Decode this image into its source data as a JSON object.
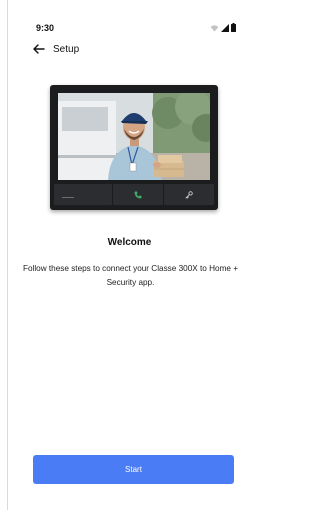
{
  "status_bar": {
    "time": "9:30",
    "icons": [
      "wifi-icon",
      "cellular-signal-icon",
      "battery-icon"
    ]
  },
  "app_bar": {
    "back_icon": "arrow-left-icon",
    "title": "Setup"
  },
  "hero": {
    "device_image": "intercom-device-with-delivery-person",
    "device_buttons": [
      "",
      "phone-icon",
      "key-icon"
    ]
  },
  "welcome": {
    "title": "Welcome",
    "body": "Follow these steps to connect your Classe 300X to Home + Security app."
  },
  "actions": {
    "start_label": "Start"
  },
  "colors": {
    "primary": "#4a7cf5",
    "device_body": "#1b1c1e",
    "device_button": "#2c2d30",
    "background": "#ffffff"
  }
}
